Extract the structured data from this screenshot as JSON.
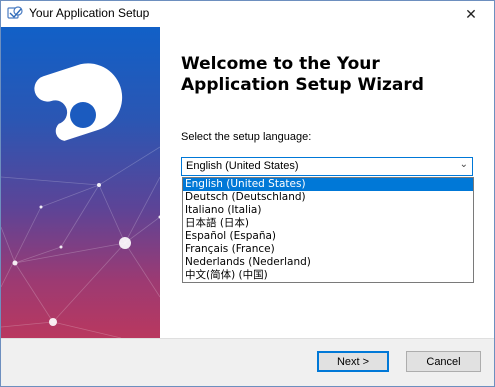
{
  "window": {
    "title": "Your Application Setup",
    "close_glyph": "✕"
  },
  "icons": {
    "app": "setup-app-icon",
    "close": "close-icon",
    "banner_logo": "puzzle-logo-icon",
    "dropdown": "chevron-down-icon"
  },
  "content": {
    "heading": "Welcome to the Your Application Setup Wizard",
    "select_label": "Select the setup language:",
    "language": {
      "selected": "English (United States)",
      "chevron_glyph": "⌄",
      "options": [
        "English (United States)",
        "Deutsch (Deutschland)",
        "Italiano (Italia)",
        "日本語 (日本)",
        "Español (España)",
        "Français (France)",
        "Nederlands (Nederland)",
        "中文(简体) (中国)"
      ],
      "highlighted_index": 0
    }
  },
  "footer": {
    "next_label": "Next >",
    "cancel_label": "Cancel"
  },
  "colors": {
    "accent": "#0078d7",
    "banner_top": "#1160c7",
    "banner_bottom": "#b9385f"
  }
}
